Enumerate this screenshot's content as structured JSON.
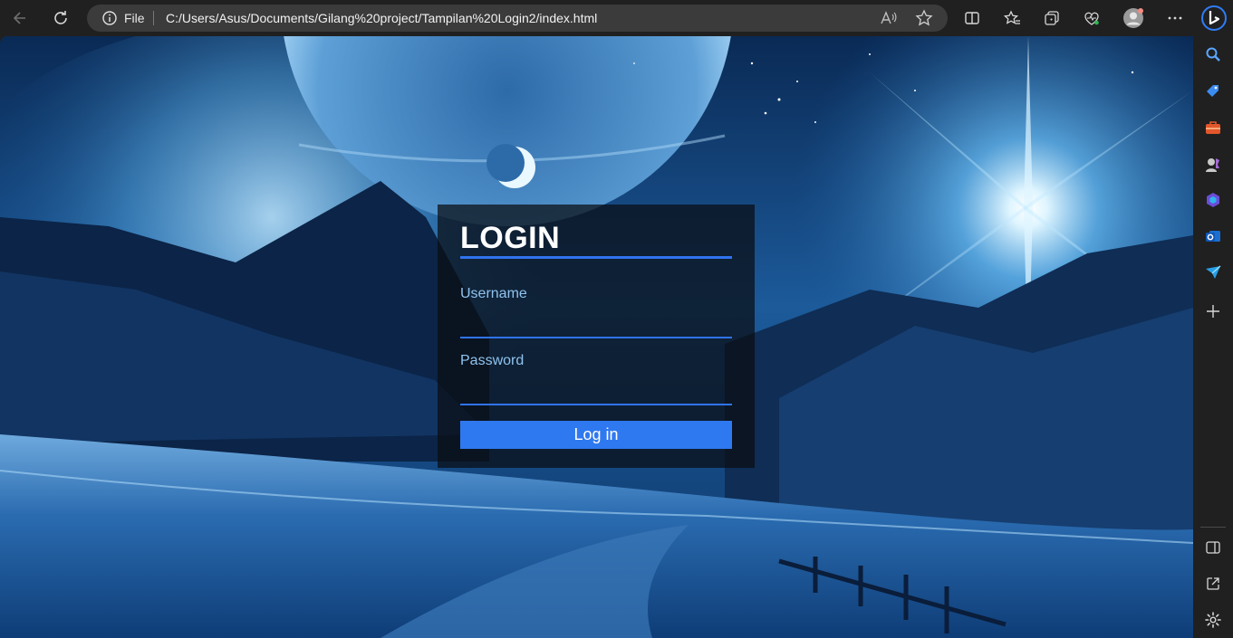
{
  "browser": {
    "address_scheme": "File",
    "address_url": "C:/Users/Asus/Documents/Gilang%20project/Tampilan%20Login2/index.html"
  },
  "login": {
    "title": "LOGIN",
    "username_label": "Username",
    "username_value": "",
    "password_label": "Password",
    "password_value": "",
    "submit_label": "Log in"
  },
  "colors": {
    "accent": "#2f73ee",
    "button": "#2f79f0",
    "label": "#8fc3ee",
    "box_bg": "rgba(10,12,18,0.72)",
    "chrome_bg": "#202020"
  },
  "icons": {
    "toolbar": [
      "back-icon",
      "refresh-icon",
      "info-icon",
      "read-aloud-icon",
      "favorite-star-icon",
      "split-screen-icon",
      "favorites-icon",
      "collections-icon",
      "browser-essentials-icon",
      "profile-avatar-icon",
      "more-options-icon",
      "bing-copilot-icon"
    ],
    "sidebar": [
      "search-icon",
      "shopping-tag-icon",
      "tools-icon",
      "games-icon",
      "microsoft-365-icon",
      "outlook-icon",
      "drop-icon",
      "add-icon",
      "hide-sidebar-icon",
      "open-external-icon",
      "settings-icon"
    ]
  }
}
